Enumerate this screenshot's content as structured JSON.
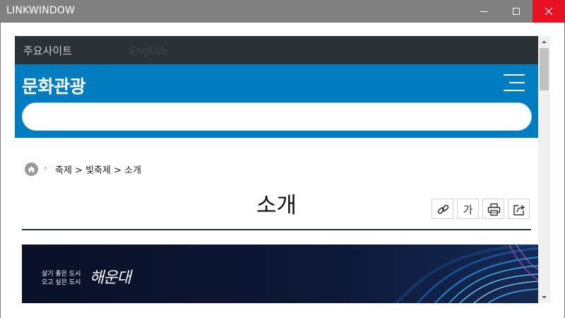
{
  "window": {
    "title": "LINKWINDOW"
  },
  "topbar": {
    "major_sites": "주요사이트",
    "language": "English"
  },
  "header": {
    "logo": "문화관광",
    "search_placeholder": ""
  },
  "breadcrumb": {
    "path": "축제 > 빛축제 > 소개"
  },
  "page": {
    "title": "소개"
  },
  "tools": {
    "font_size_label": "가"
  },
  "banner": {
    "slogan_line1": "살기 좋은 도시",
    "slogan_line2": "오고 싶은 도시",
    "brand": "해운대"
  },
  "colors": {
    "titlebar": "#808080",
    "close_button": "#e81123",
    "topbar": "#2a3137",
    "header": "#007dc1",
    "banner": "#0d1630"
  },
  "icons": {
    "home": "home-icon",
    "link": "link-icon",
    "print": "print-icon",
    "share": "share-icon",
    "menu": "hamburger-icon"
  }
}
